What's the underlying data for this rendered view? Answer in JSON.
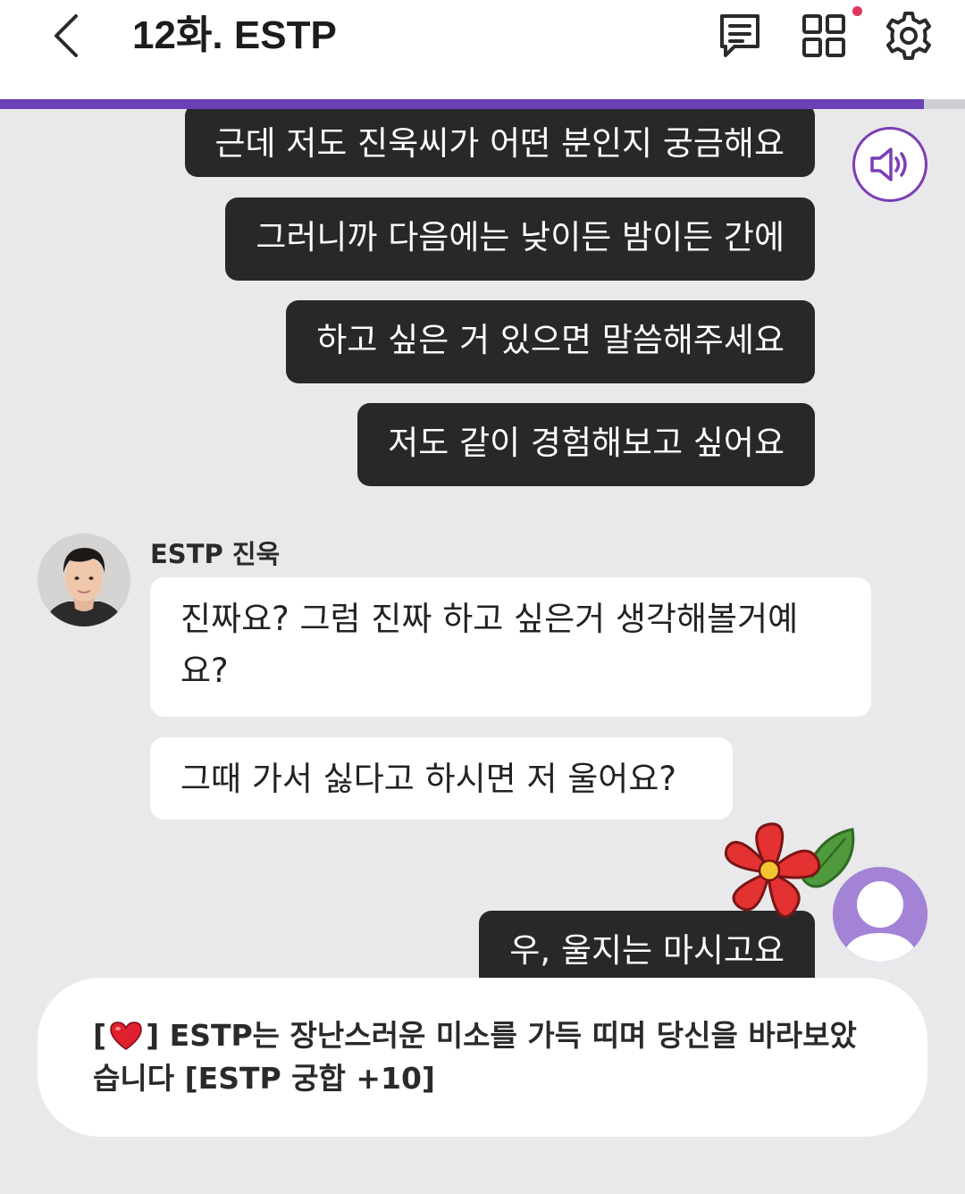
{
  "header": {
    "title": "12화. ESTP",
    "back_icon": "chevron-left-icon",
    "chat_log_icon": "message-list-icon",
    "menu_icon": "grid-icon",
    "settings_icon": "gear-icon",
    "notification_dot": true,
    "progress": 0.957,
    "accent_color": "#6b3fb6"
  },
  "chat": {
    "my_messages_top": [
      "근데 저도 진욱씨가 어떤 분인지 궁금해요",
      "그러니까 다음에는 낮이든 밤이든 간에",
      "하고 싶은 거 있으면 말씀해주세요",
      "저도 같이 경험해보고 싶어요"
    ],
    "partner": {
      "name": "ESTP 진욱",
      "messages": [
        "진짜요? 그럼 진짜 하고 싶은거 생각해볼거예요?",
        "그때 가서 싫다고 하시면 저 울어요?"
      ]
    },
    "my_message_last": "우, 울지는 마시고요",
    "speaker_icon": "speaker-icon"
  },
  "narration": {
    "heart_icon": "heart-icon",
    "text_open": "[",
    "text_close": "] ESTP는 장난스러운 미소를 가득 띠며 당신을 바라보았습니다 [ESTP 궁합 +10]"
  }
}
